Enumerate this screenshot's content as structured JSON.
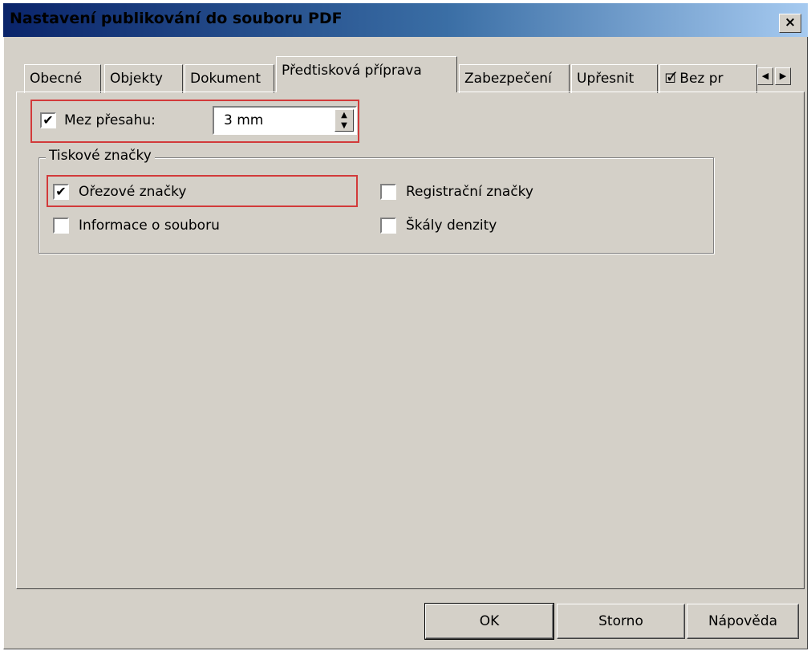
{
  "window": {
    "title": "Nastavení publikování do souboru PDF",
    "close_label": "×"
  },
  "tabs": [
    {
      "label": "Obecné"
    },
    {
      "label": "Objekty"
    },
    {
      "label": "Dokument"
    },
    {
      "label": "Předtisková příprava",
      "active": true
    },
    {
      "label": "Zabezpečení"
    },
    {
      "label": "Upřesnit"
    },
    {
      "label": "Bez pr",
      "icon": "check-document-icon"
    }
  ],
  "bleed": {
    "checked": true,
    "label": "Mez přesahu:",
    "value": "3 mm"
  },
  "print_marks": {
    "title": "Tiskové značky",
    "items": [
      {
        "label": "Ořezové značky",
        "checked": true
      },
      {
        "label": "Registrační značky",
        "checked": false
      },
      {
        "label": "Informace o souboru",
        "checked": false
      },
      {
        "label": "Škály denzity",
        "checked": false
      }
    ]
  },
  "buttons": {
    "ok": "OK",
    "cancel": "Storno",
    "help": "Nápověda"
  },
  "icons": {
    "check_mark": "✔",
    "scroll_left": "◀",
    "scroll_right": "▶",
    "spin_up": "▲",
    "spin_down": "▼"
  },
  "colors": {
    "dialog_bg": "#d4d0c8",
    "highlight_box": "#d23a3a"
  }
}
